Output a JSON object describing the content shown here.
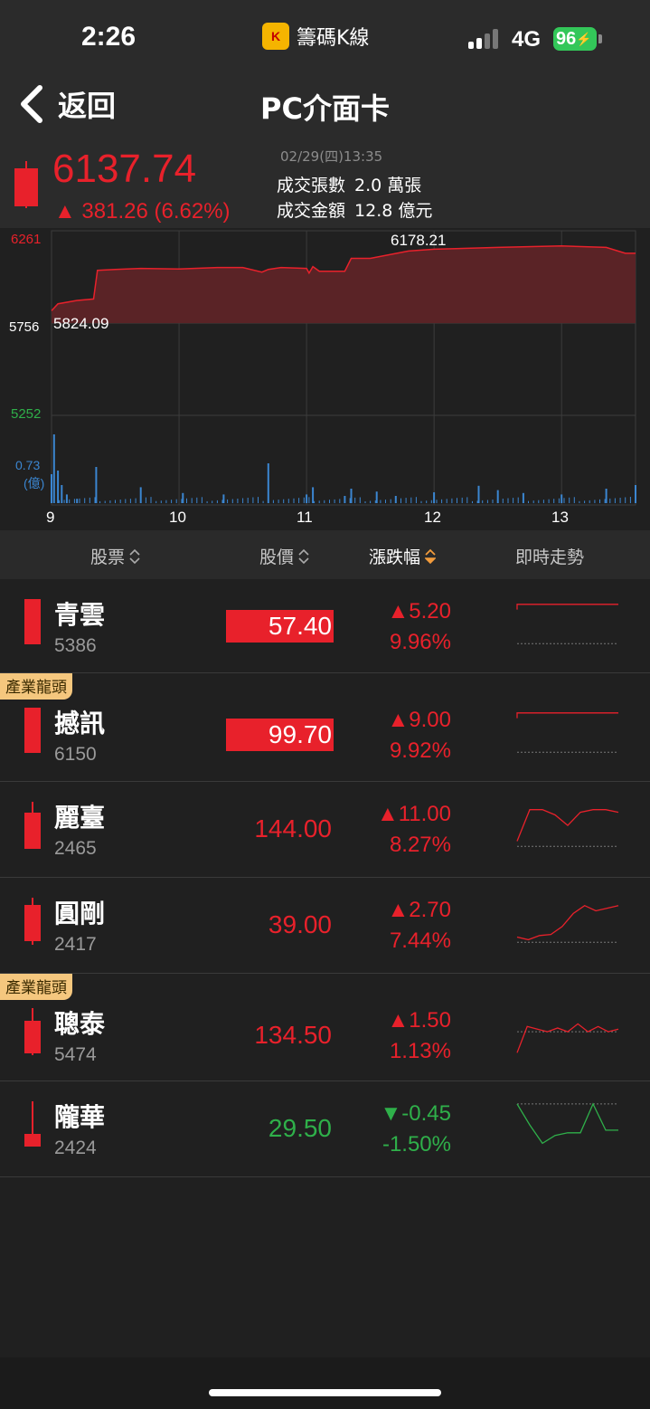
{
  "status": {
    "time": "2:26",
    "app_name": "籌碼K線",
    "network": "4G",
    "battery": "96"
  },
  "nav": {
    "back_label": "返回",
    "title": "PC介面卡"
  },
  "index": {
    "price": "6137.74",
    "change": "▲ 381.26 (6.62%)",
    "datetime": "02/29(四)13:35",
    "volume_label": "成交張數",
    "volume_value": "2.0 萬張",
    "amount_label": "成交金額",
    "amount_value": "12.8 億元"
  },
  "chart_data": {
    "type": "line",
    "y_ticks": [
      "6261",
      "5756",
      "5252"
    ],
    "ylim": [
      5252,
      6261
    ],
    "reference": 5756,
    "high_label": "6178.21",
    "low_label": "5824.09",
    "volume_tick": "0.73",
    "volume_unit": "(億)",
    "x_ticks": [
      "9",
      "10",
      "11",
      "12",
      "13"
    ],
    "colors": {
      "line": "#e8212b",
      "fill": "#5a2326",
      "volume": "#3b86d1",
      "grid": "#3c3c3c"
    },
    "series": [
      {
        "x": [
          9.0,
          9.05,
          9.2,
          9.33,
          9.36,
          9.5,
          9.7,
          10.0,
          10.3,
          10.5,
          10.65,
          10.7,
          10.8,
          11.0,
          11.02,
          11.05,
          11.1,
          11.3,
          11.35,
          11.5,
          11.8,
          12.0,
          12.5,
          13.0,
          13.35,
          13.5,
          13.58
        ],
        "y": [
          5824,
          5862,
          5880,
          5888,
          6045,
          6050,
          6055,
          6052,
          6060,
          6060,
          6035,
          6050,
          6060,
          6055,
          6030,
          6065,
          6040,
          6040,
          6110,
          6110,
          6150,
          6160,
          6170,
          6178,
          6170,
          6138,
          6138
        ]
      }
    ],
    "volume": {
      "x": [
        9.0,
        9.02,
        9.05,
        9.08,
        9.12,
        9.2,
        9.35,
        9.7,
        10.03,
        10.35,
        10.7,
        11.0,
        11.05,
        11.3,
        11.35,
        11.55,
        11.7,
        12.0,
        12.35,
        12.5,
        12.7,
        13.0,
        13.35,
        13.58
      ],
      "values": [
        0.4,
        0.95,
        0.45,
        0.25,
        0.12,
        0.06,
        0.5,
        0.22,
        0.14,
        0.12,
        0.55,
        0.12,
        0.22,
        0.1,
        0.2,
        0.16,
        0.1,
        0.15,
        0.24,
        0.18,
        0.14,
        0.12,
        0.2,
        0.25
      ]
    }
  },
  "table": {
    "headers": {
      "stock": "股票",
      "price": "股價",
      "change": "漲跌幅",
      "trend": "即時走勢"
    },
    "rows": [
      {
        "name": "青雲",
        "code": "5386",
        "price": "57.40",
        "change": "▲5.20",
        "pct": "9.96%",
        "badge": "",
        "direction": "up",
        "limit_up": true,
        "trend": [
          0.1,
          0.1,
          0.1,
          0.1,
          0.1,
          0.1
        ],
        "baseline": 0.85
      },
      {
        "name": "撼訊",
        "code": "6150",
        "price": "99.70",
        "change": "▲9.00",
        "pct": "9.92%",
        "badge": "產業龍頭",
        "direction": "up",
        "limit_up": true,
        "trend": [
          0.1,
          0.1,
          0.1,
          0.1,
          0.1,
          0.1
        ],
        "baseline": 0.85
      },
      {
        "name": "麗臺",
        "code": "2465",
        "price": "144.00",
        "change": "▲11.00",
        "pct": "8.27%",
        "badge": "",
        "direction": "up",
        "limit_up": false,
        "trend": [
          0.75,
          0.15,
          0.15,
          0.25,
          0.45,
          0.2,
          0.15,
          0.15,
          0.2
        ],
        "baseline": 0.85
      },
      {
        "name": "圓剛",
        "code": "2417",
        "price": "39.00",
        "change": "▲2.70",
        "pct": "7.44%",
        "badge": "",
        "direction": "up",
        "limit_up": false,
        "trend": [
          0.75,
          0.8,
          0.72,
          0.7,
          0.55,
          0.3,
          0.15,
          0.25,
          0.2,
          0.15
        ],
        "baseline": 0.85
      },
      {
        "name": "聰泰",
        "code": "5474",
        "price": "134.50",
        "change": "▲1.50",
        "pct": "1.13%",
        "badge": "產業龍頭",
        "direction": "up",
        "limit_up": false,
        "trend": [
          0.85,
          0.35,
          0.4,
          0.45,
          0.38,
          0.45,
          0.3,
          0.45,
          0.35,
          0.45,
          0.4
        ],
        "baseline": 0.45
      },
      {
        "name": "隴華",
        "code": "2424",
        "price": "29.50",
        "change": "▼-0.45",
        "pct": "-1.50%",
        "badge": "",
        "direction": "down",
        "limit_up": false,
        "trend": [
          0.05,
          0.45,
          0.8,
          0.65,
          0.6,
          0.6,
          0.05,
          0.55,
          0.55
        ],
        "baseline": 0.05
      }
    ]
  }
}
